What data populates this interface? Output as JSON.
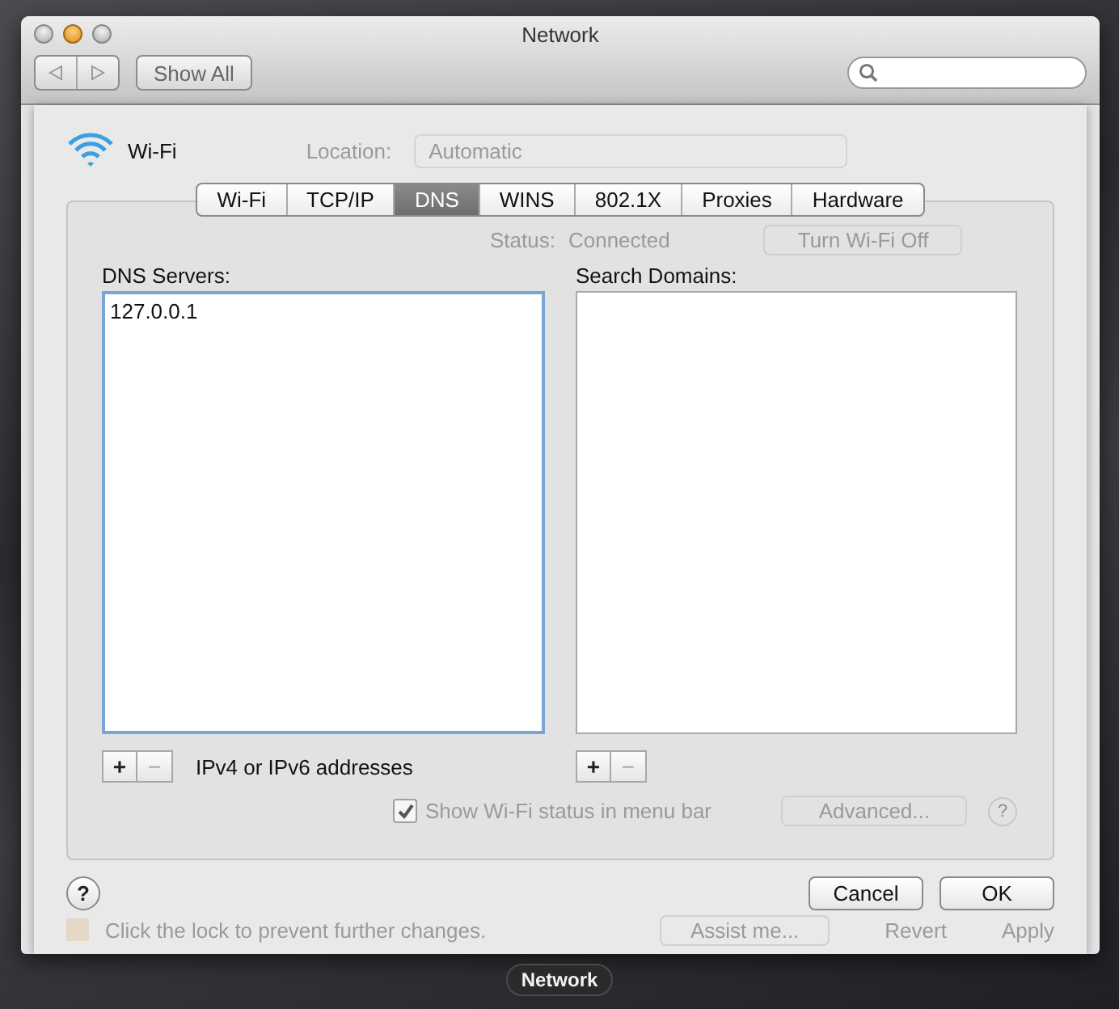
{
  "window": {
    "title": "Network",
    "show_all": "Show All"
  },
  "interface": {
    "name": "Wi-Fi"
  },
  "location": {
    "label": "Location:",
    "value": "Automatic"
  },
  "tabs": [
    {
      "label": "Wi-Fi",
      "selected": false
    },
    {
      "label": "TCP/IP",
      "selected": false
    },
    {
      "label": "DNS",
      "selected": true
    },
    {
      "label": "WINS",
      "selected": false
    },
    {
      "label": "802.1X",
      "selected": false
    },
    {
      "label": "Proxies",
      "selected": false
    },
    {
      "label": "Hardware",
      "selected": false
    }
  ],
  "status": {
    "label": "Status:",
    "value": "Connected",
    "button": "Turn Wi-Fi Off"
  },
  "dns_servers": {
    "label": "DNS Servers:",
    "entries": [
      "127.0.0.1"
    ],
    "add": "+",
    "remove": "−",
    "hint": "IPv4 or IPv6 addresses"
  },
  "search_domains": {
    "label": "Search Domains:",
    "add": "+",
    "remove": "−"
  },
  "menu_bar_option": {
    "label": "Show Wi-Fi status in menu bar",
    "checked": true,
    "advanced": "Advanced...",
    "help": "?"
  },
  "sheet_buttons": {
    "help": "?",
    "cancel": "Cancel",
    "ok": "OK"
  },
  "lock_row": {
    "text": "Click the lock to prevent further changes.",
    "assist": "Assist me...",
    "revert": "Revert",
    "apply": "Apply"
  },
  "dock_label": "Network"
}
